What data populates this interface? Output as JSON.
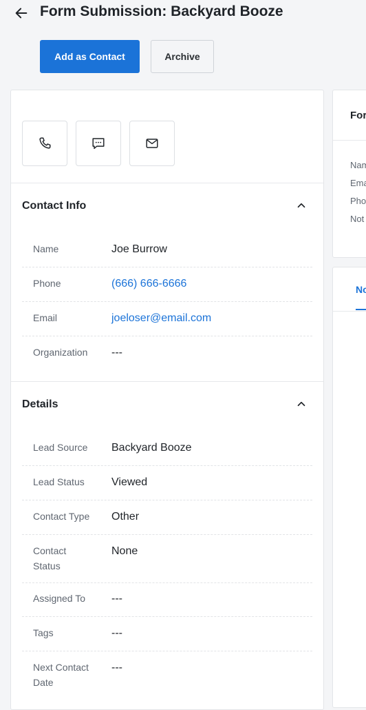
{
  "header": {
    "title": "Form Submission: Backyard Booze",
    "back_icon": "arrow-left-icon"
  },
  "actions": {
    "add_contact": "Add as Contact",
    "archive": "Archive"
  },
  "colors": {
    "accent": "#1b73d8",
    "background": "#f4f5f7"
  },
  "quick_actions": [
    {
      "icon": "phone-icon"
    },
    {
      "icon": "message-icon"
    },
    {
      "icon": "mail-icon"
    }
  ],
  "contact_info": {
    "title": "Contact Info",
    "rows": [
      {
        "label": "Name",
        "value": "Joe Burrow"
      },
      {
        "label": "Phone",
        "value": "(666) 666-6666"
      },
      {
        "label": "Email",
        "value": "joeloser@email.com"
      },
      {
        "label": "Organization",
        "value": "---"
      }
    ]
  },
  "details": {
    "title": "Details",
    "rows": [
      {
        "label": "Lead Source",
        "value": "Backyard Booze"
      },
      {
        "label": "Lead Status",
        "value": "Viewed"
      },
      {
        "label": "Contact Type",
        "value": "Other"
      },
      {
        "label": "Contact Status",
        "value": "None"
      },
      {
        "label": "Assigned To",
        "value": "---"
      },
      {
        "label": "Tags",
        "value": "---"
      },
      {
        "label": "Next Contact Date",
        "value": "---"
      }
    ]
  },
  "right_panel": {
    "title": "For",
    "labels": [
      "Nam",
      "Ema",
      "Pho",
      "Not"
    ],
    "tab": "No"
  }
}
